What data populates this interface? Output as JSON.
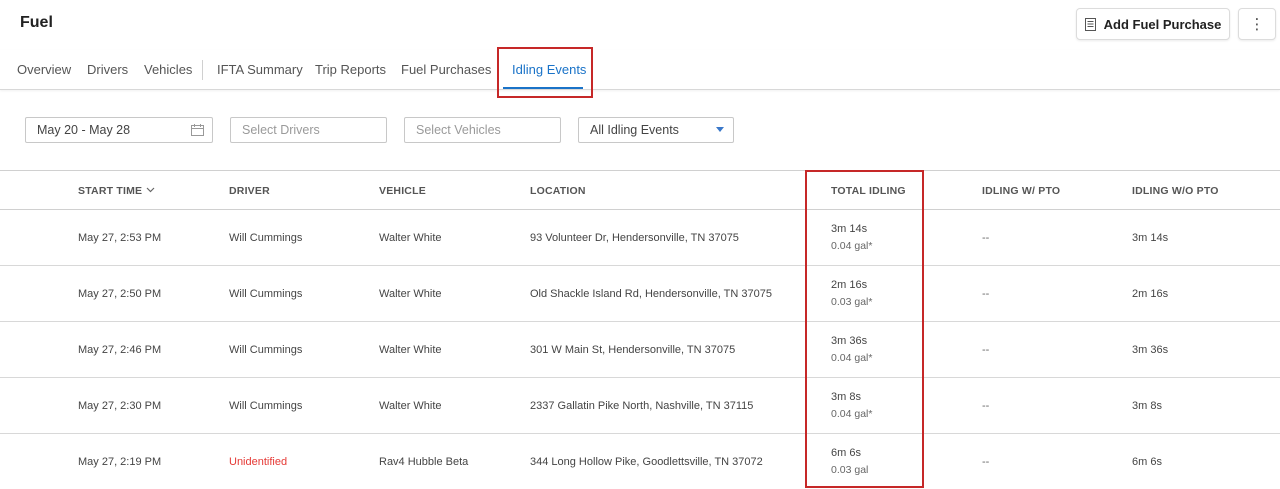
{
  "header": {
    "title": "Fuel",
    "add_button": "Add Fuel Purchase",
    "more_button": "⋮"
  },
  "tabs": [
    "Overview",
    "Drivers",
    "Vehicles",
    "IFTA Summary",
    "Trip Reports",
    "Fuel Purchases",
    "Idling Events"
  ],
  "active_tab": "Idling Events",
  "filters": {
    "date_range": "May 20 - May 28",
    "drivers_placeholder": "Select Drivers",
    "vehicles_placeholder": "Select Vehicles",
    "event_type": "All Idling Events"
  },
  "table": {
    "columns": [
      "START TIME",
      "DRIVER",
      "VEHICLE",
      "LOCATION",
      "TOTAL IDLING",
      "IDLING W/ PTO",
      "IDLING W/O PTO"
    ],
    "rows": [
      {
        "start": "May 27, 2:53 PM",
        "driver": "Will Cummings",
        "vehicle": "Walter White",
        "location": "93 Volunteer Dr, Hendersonville, TN 37075",
        "total": "3m 14s",
        "gal": "0.04 gal*",
        "pto": "--",
        "wo_pto": "3m 14s"
      },
      {
        "start": "May 27, 2:50 PM",
        "driver": "Will Cummings",
        "vehicle": "Walter White",
        "location": "Old Shackle Island Rd, Hendersonville, TN 37075",
        "total": "2m 16s",
        "gal": "0.03 gal*",
        "pto": "--",
        "wo_pto": "2m 16s"
      },
      {
        "start": "May 27, 2:46 PM",
        "driver": "Will Cummings",
        "vehicle": "Walter White",
        "location": "301 W Main St, Hendersonville, TN 37075",
        "total": "3m 36s",
        "gal": "0.04 gal*",
        "pto": "--",
        "wo_pto": "3m 36s"
      },
      {
        "start": "May 27, 2:30 PM",
        "driver": "Will Cummings",
        "vehicle": "Walter White",
        "location": "2337 Gallatin Pike North, Nashville, TN 37115",
        "total": "3m 8s",
        "gal": "0.04 gal*",
        "pto": "--",
        "wo_pto": "3m 8s"
      },
      {
        "start": "May 27, 2:19 PM",
        "driver": "Unidentified",
        "vehicle": "Rav4 Hubble Beta",
        "location": "344 Long Hollow Pike, Goodlettsville, TN 37072",
        "total": "6m 6s",
        "gal": "0.03 gal",
        "pto": "--",
        "wo_pto": "6m 6s"
      }
    ]
  },
  "colors": {
    "accent": "#1a73c8",
    "highlight": "#c62828",
    "unidentified": "#e53935"
  }
}
